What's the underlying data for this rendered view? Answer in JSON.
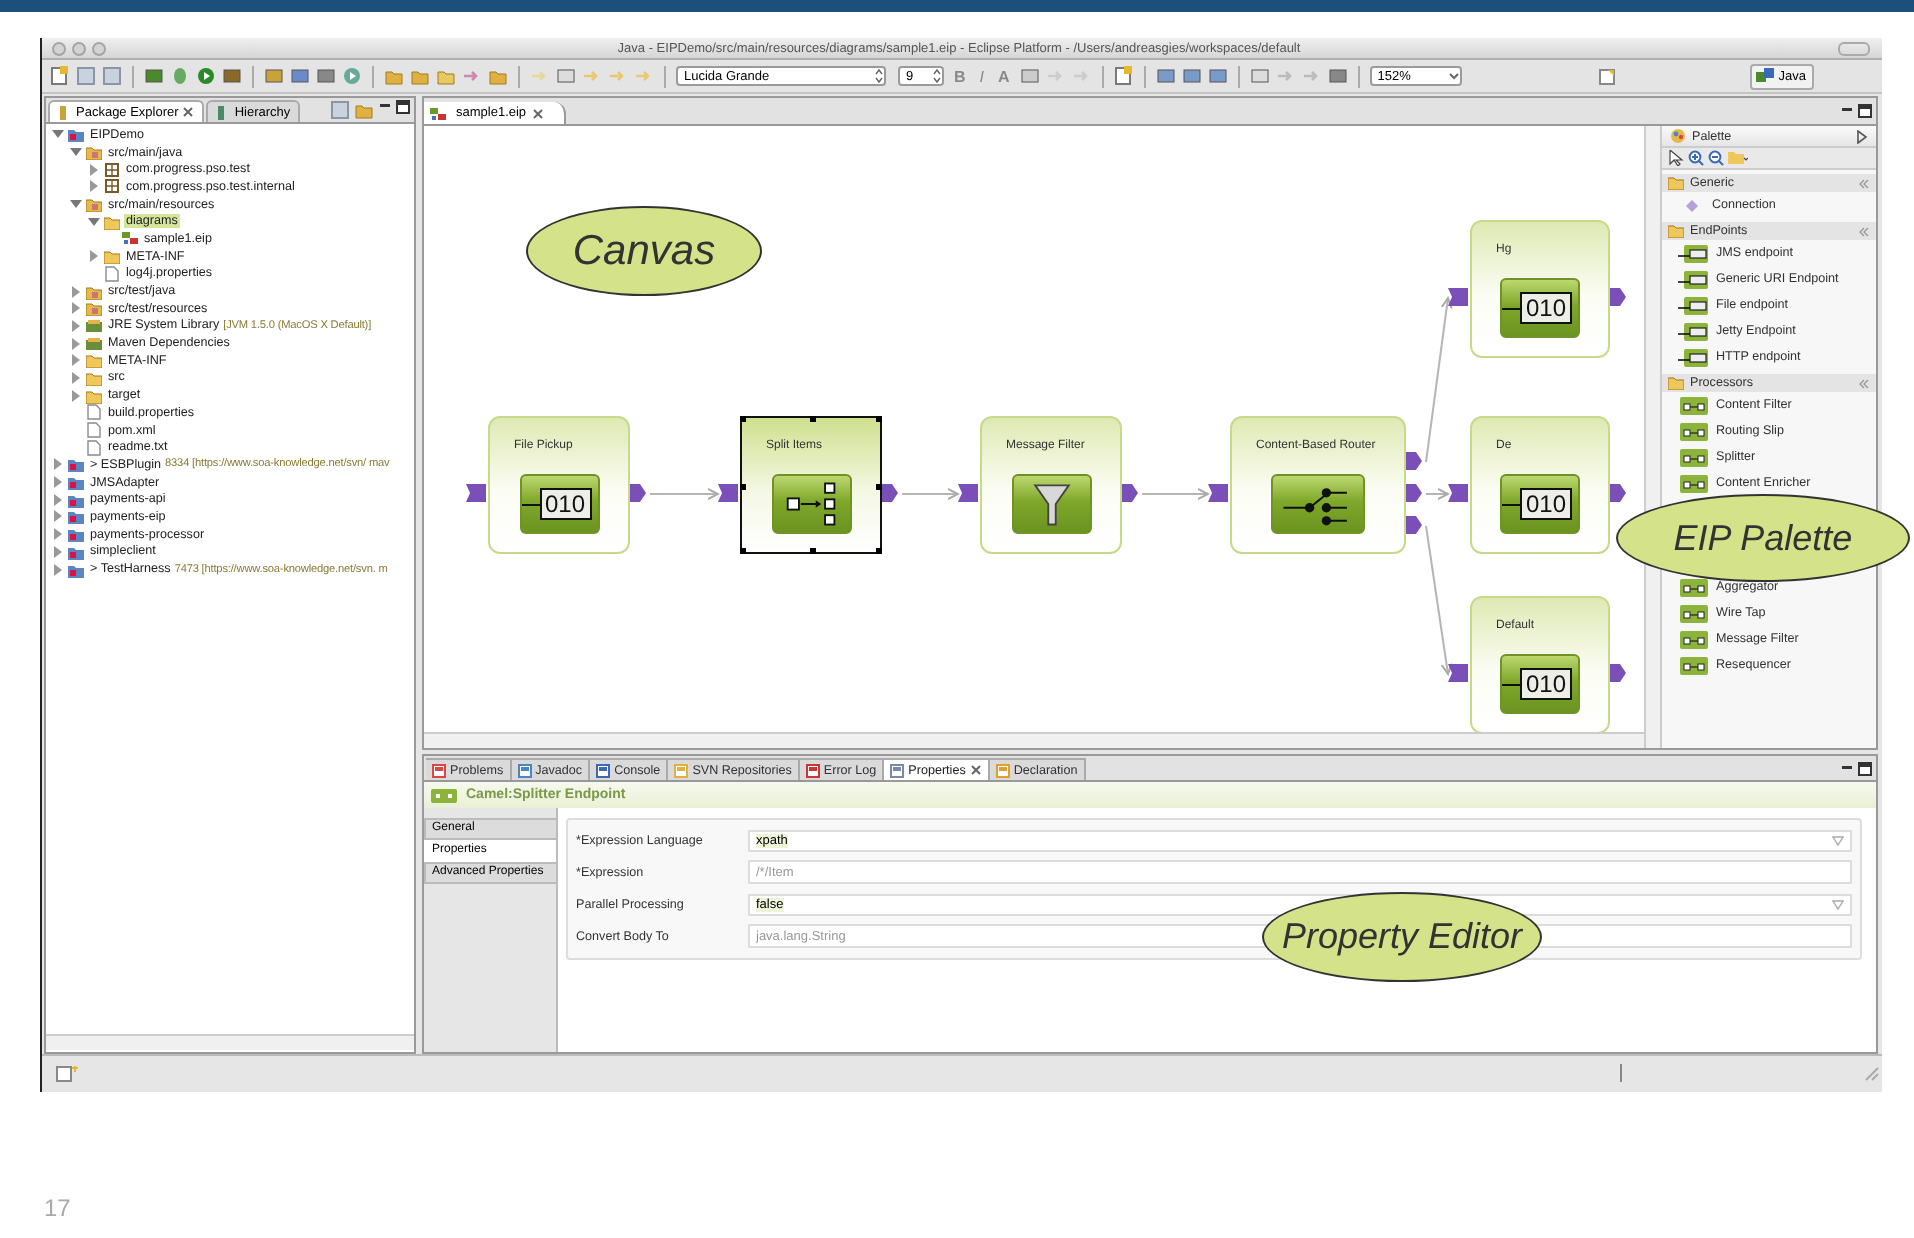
{
  "slide": {
    "page_number": "17"
  },
  "window": {
    "title": "Java - EIPDemo/src/main/resources/diagrams/sample1.eip - Eclipse Platform - /Users/andreasgies/workspaces/default"
  },
  "toolbar": {
    "font": "Lucida Grande",
    "font_size": "9",
    "format_buttons": [
      {
        "label": "B",
        "disabled": true
      },
      {
        "label": "I",
        "disabled": true
      },
      {
        "label": "A",
        "disabled": true
      }
    ],
    "zoom": "152%",
    "perspective": "Java"
  },
  "left_panel": {
    "tabs": [
      {
        "label": "Package Explorer",
        "selected": true
      },
      {
        "label": "Hierarchy",
        "selected": false
      }
    ],
    "tree": [
      {
        "label": "EIPDemo",
        "kind": "project",
        "expanded": true,
        "selected": false,
        "children": [
          {
            "label": "src/main/java",
            "kind": "srcfolder",
            "expanded": true,
            "selected": false,
            "children": [
              {
                "label": "com.progress.pso.test",
                "kind": "package",
                "expanded": false,
                "selected": false
              },
              {
                "label": "com.progress.pso.test.internal",
                "kind": "package",
                "expanded": false,
                "selected": false
              }
            ]
          },
          {
            "label": "src/main/resources",
            "kind": "srcfolder",
            "expanded": true,
            "selected": false,
            "children": [
              {
                "label": "diagrams",
                "kind": "folder",
                "expanded": true,
                "selected": true,
                "children": [
                  {
                    "label": "sample1.eip",
                    "kind": "diagram",
                    "selected": false
                  }
                ]
              },
              {
                "label": "META-INF",
                "kind": "folder",
                "expanded": false,
                "selected": false
              },
              {
                "label": "log4j.properties",
                "kind": "file",
                "selected": false
              }
            ]
          },
          {
            "label": "src/test/java",
            "kind": "srcfolder",
            "expanded": false,
            "selected": false
          },
          {
            "label": "src/test/resources",
            "kind": "srcfolder",
            "expanded": false,
            "selected": false
          },
          {
            "label": "JRE System Library",
            "note": "[JVM 1.5.0 (MacOS X Default)]",
            "kind": "library",
            "expanded": false,
            "selected": false
          },
          {
            "label": "Maven Dependencies",
            "kind": "library",
            "expanded": false,
            "selected": false
          },
          {
            "label": "META-INF",
            "kind": "folder",
            "expanded": false,
            "selected": false
          },
          {
            "label": "src",
            "kind": "folder",
            "expanded": false,
            "selected": false
          },
          {
            "label": "target",
            "kind": "folder",
            "expanded": false,
            "selected": false
          },
          {
            "label": "build.properties",
            "kind": "file",
            "selected": false
          },
          {
            "label": "pom.xml",
            "kind": "file",
            "selected": false
          },
          {
            "label": "readme.txt",
            "kind": "file",
            "selected": false
          }
        ]
      },
      {
        "label": "> ESBPlugin",
        "note": "8334 [https://www.soa-knowledge.net/svn/ mav",
        "kind": "project",
        "expanded": false,
        "selected": false
      },
      {
        "label": "JMSAdapter",
        "kind": "project",
        "expanded": false,
        "selected": false
      },
      {
        "label": "payments-api",
        "kind": "project",
        "expanded": false,
        "selected": false
      },
      {
        "label": "payments-eip",
        "kind": "project",
        "expanded": false,
        "selected": false
      },
      {
        "label": "payments-processor",
        "kind": "project",
        "expanded": false,
        "selected": false
      },
      {
        "label": "simpleclient",
        "kind": "project",
        "expanded": false,
        "selected": false
      },
      {
        "label": "> TestHarness",
        "note": "7473 [https://www.soa-knowledge.net/svn. m",
        "kind": "project",
        "expanded": false,
        "selected": false
      }
    ]
  },
  "editor": {
    "tabs": [
      {
        "label": "sample1.eip",
        "selected": true
      }
    ],
    "nodes": [
      {
        "label": "File Pickup",
        "kind": "endpoint",
        "code": "010",
        "selected": false
      },
      {
        "label": "Split Items",
        "kind": "splitter",
        "selected": true
      },
      {
        "label": "Message Filter",
        "kind": "filter",
        "selected": false
      },
      {
        "label": "Content-Based Router",
        "kind": "router",
        "selected": false
      },
      {
        "label": "Hg",
        "kind": "endpoint",
        "code": "010",
        "selected": false
      },
      {
        "label": "De",
        "kind": "endpoint",
        "code": "010",
        "selected": false
      },
      {
        "label": "Default",
        "kind": "endpoint",
        "code": "010",
        "selected": false
      }
    ]
  },
  "palette": {
    "title": "Palette",
    "drawers": [
      {
        "label": "Generic",
        "expanded": true,
        "items": [
          {
            "label": "Connection",
            "kind": "connection"
          }
        ]
      },
      {
        "label": "EndPoints",
        "expanded": true,
        "items": [
          {
            "label": "JMS endpoint",
            "kind": "endpoint"
          },
          {
            "label": "Generic URI Endpoint",
            "kind": "endpoint"
          },
          {
            "label": "File endpoint",
            "kind": "endpoint"
          },
          {
            "label": "Jetty Endpoint",
            "kind": "endpoint"
          },
          {
            "label": "HTTP endpoint",
            "kind": "endpoint"
          }
        ]
      },
      {
        "label": "Processors",
        "expanded": true,
        "items": [
          {
            "label": "Content Filter",
            "kind": "processor"
          },
          {
            "label": "Routing Slip",
            "kind": "processor"
          },
          {
            "label": "Splitter",
            "kind": "processor"
          },
          {
            "label": "Content Enricher",
            "kind": "processor"
          },
          {
            "label": "Aggregator",
            "kind": "processor"
          },
          {
            "label": "Wire Tap",
            "kind": "processor"
          },
          {
            "label": "Message Filter",
            "kind": "processor"
          },
          {
            "label": "Resequencer",
            "kind": "processor"
          }
        ]
      }
    ]
  },
  "bottom_panel": {
    "tabs": [
      {
        "label": "Problems",
        "selected": false
      },
      {
        "label": "Javadoc",
        "selected": false
      },
      {
        "label": "Console",
        "selected": false
      },
      {
        "label": "SVN Repositories",
        "selected": false
      },
      {
        "label": "Error Log",
        "selected": false
      },
      {
        "label": "Properties",
        "selected": true
      },
      {
        "label": "Declaration",
        "selected": false
      }
    ],
    "title": "Camel:Splitter Endpoint",
    "sections": [
      {
        "label": "General",
        "selected": false
      },
      {
        "label": "Properties",
        "selected": true
      },
      {
        "label": "Advanced Properties",
        "selected": false
      }
    ],
    "fields": [
      {
        "label": "*Expression Language",
        "kind": "combo",
        "value": "xpath"
      },
      {
        "label": "*Expression",
        "kind": "text",
        "placeholder": "/*/Item"
      },
      {
        "label": "Parallel Processing",
        "kind": "combo",
        "value": "false"
      },
      {
        "label": "Convert Body To",
        "kind": "text",
        "placeholder": "java.lang.String"
      }
    ]
  },
  "callouts": [
    {
      "label": "Canvas"
    },
    {
      "label": "EIP Palette"
    },
    {
      "label": "Property Editor"
    }
  ]
}
